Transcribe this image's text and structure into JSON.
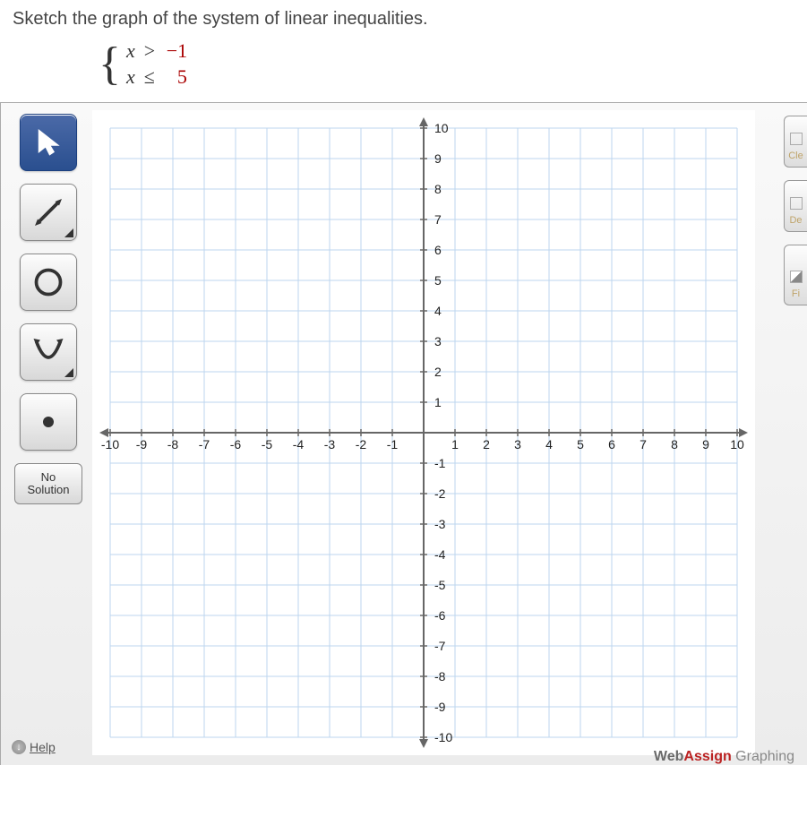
{
  "prompt": "Sketch the graph of the system of linear inequalities.",
  "system": {
    "row1": {
      "var": "x",
      "op": ">",
      "val": "−1"
    },
    "row2": {
      "var": "x",
      "op": "≤",
      "val": "5"
    }
  },
  "tools": {
    "no_solution": "No\nSolution"
  },
  "right": {
    "clear": "Cle",
    "del": "De",
    "fill": "Fi"
  },
  "help": "Help",
  "footer": {
    "a": "Web",
    "b": "Assign",
    "c": " Graphing"
  },
  "chart_data": {
    "type": "scatter",
    "title": "",
    "xlabel": "",
    "ylabel": "",
    "xlim": [
      -10,
      10
    ],
    "ylim": [
      -10,
      10
    ],
    "xticks": [
      -10,
      -9,
      -8,
      -7,
      -6,
      -5,
      -4,
      -3,
      -2,
      -1,
      1,
      2,
      3,
      4,
      5,
      6,
      7,
      8,
      9,
      10
    ],
    "yticks": [
      -10,
      -9,
      -8,
      -7,
      -6,
      -5,
      -4,
      -3,
      -2,
      -1,
      1,
      2,
      3,
      4,
      5,
      6,
      7,
      8,
      9,
      10
    ],
    "series": []
  }
}
